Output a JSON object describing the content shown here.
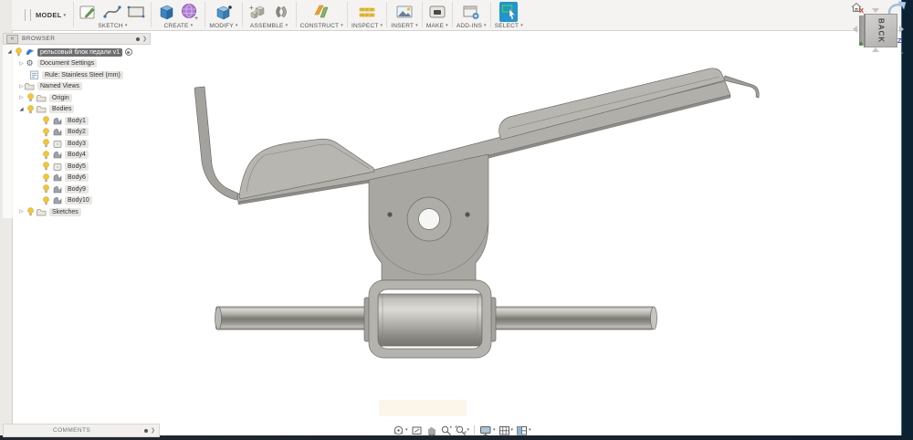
{
  "toolbar": {
    "model_label": "MODEL",
    "groups": [
      {
        "label": "SKETCH",
        "icons": [
          "create-sketch-icon",
          "spline-icon",
          "rectangle-icon"
        ]
      },
      {
        "label": "CREATE",
        "icons": [
          "box-icon",
          "form-sphere-icon"
        ]
      },
      {
        "label": "MODIFY",
        "icons": [
          "press-pull-icon"
        ]
      },
      {
        "label": "ASSEMBLE",
        "icons": [
          "new-component-icon",
          "joint-icon"
        ]
      },
      {
        "label": "CONSTRUCT",
        "icons": [
          "construction-plane-icon"
        ]
      },
      {
        "label": "INSPECT",
        "icons": [
          "measure-icon"
        ]
      },
      {
        "label": "INSERT",
        "icons": [
          "insert-image-icon"
        ]
      },
      {
        "label": "MAKE",
        "icons": [
          "3d-print-icon"
        ]
      },
      {
        "label": "ADD-INS",
        "icons": [
          "add-ins-icon"
        ]
      },
      {
        "label": "SELECT",
        "icons": [
          "select-icon"
        ]
      }
    ]
  },
  "browser": {
    "header": "BROWSER",
    "tree": [
      {
        "label": "рельсовый блок педали v1",
        "icon": "share-icon",
        "selected": true,
        "state": "expanded"
      },
      {
        "label": "Document Settings",
        "icon": "gear-icon",
        "state": "collapsed"
      },
      {
        "label": "Rule: Stainless Steel (mm)",
        "icon": "rule-icon"
      },
      {
        "label": "Named Views",
        "icon": "folder-icon",
        "state": "collapsed"
      },
      {
        "label": "Origin",
        "icon": "folder-icon",
        "state": "collapsed",
        "visible": true
      },
      {
        "label": "Bodies",
        "icon": "folder-icon",
        "state": "expanded",
        "visible": true
      },
      {
        "label": "Body1",
        "icon": "surface-body-icon",
        "visible": true
      },
      {
        "label": "Body2",
        "icon": "surface-body-icon",
        "visible": true
      },
      {
        "label": "Body3",
        "icon": "flat-body-icon",
        "visible": true
      },
      {
        "label": "Body4",
        "icon": "surface-body-icon",
        "visible": true
      },
      {
        "label": "Body5",
        "icon": "flat-body-icon",
        "visible": true
      },
      {
        "label": "Body6",
        "icon": "surface-body-icon",
        "visible": true
      },
      {
        "label": "Body9",
        "icon": "surface-body-icon",
        "visible": true
      },
      {
        "label": "Body10",
        "icon": "surface-body-icon",
        "visible": true
      },
      {
        "label": "Sketches",
        "icon": "folder-icon",
        "state": "collapsed",
        "visible": true
      }
    ]
  },
  "viewcube": {
    "face": "BACK",
    "axis_x": "X",
    "axis_z": "Z"
  },
  "comments": {
    "label": "COMMENTS"
  },
  "navbar": {
    "icons": [
      "orbit-icon",
      "look-at-icon",
      "pan-icon",
      "zoom-icon",
      "fit-icon",
      "display-settings-icon",
      "grid-settings-icon",
      "viewports-icon"
    ]
  },
  "colors": {
    "select_active": "#2095d2",
    "selection_gray": "#6e6e6e",
    "model_gray": "#adaca6",
    "chrome": "#f4f3f1",
    "edge_dark": "#0c2132"
  }
}
